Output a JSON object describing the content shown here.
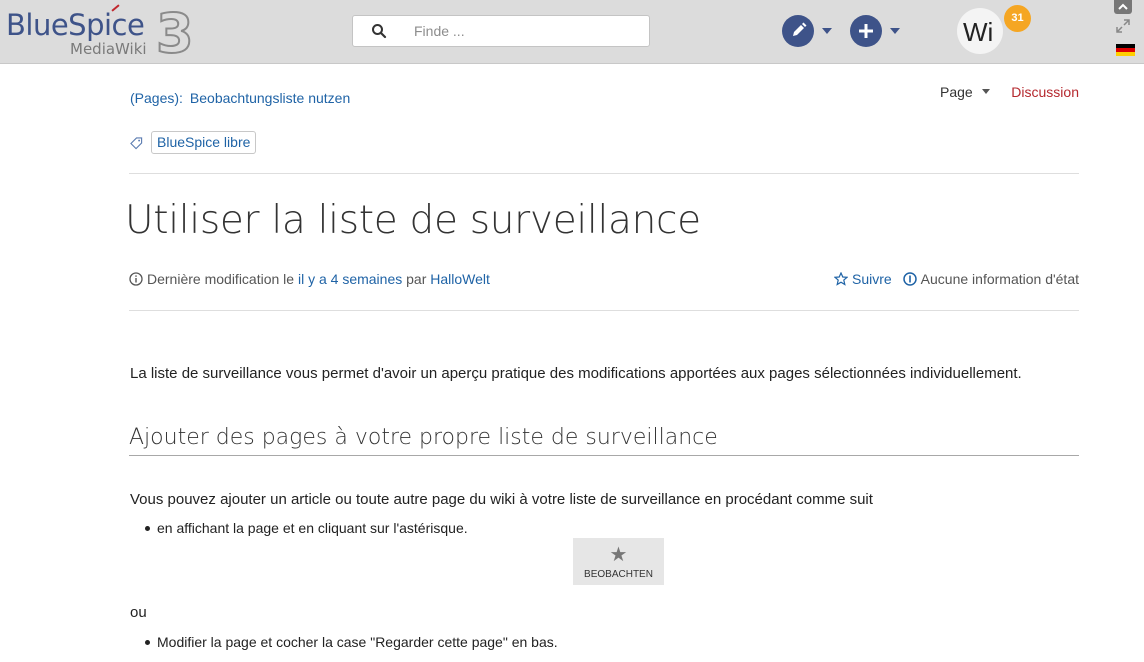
{
  "header": {
    "logo_main": "BlueSpice",
    "logo_sub": "MediaWiki",
    "logo_version": "3",
    "search_placeholder": "Finde ...",
    "avatar_initials": "Wi",
    "notification_count": "31",
    "colors": {
      "brand": "#3e5389",
      "badge": "#f5a623"
    }
  },
  "page": {
    "breadcrumb_prefix": "(Pages):",
    "breadcrumb_page": "Beobachtungsliste nutzen",
    "tab_page": "Page",
    "tab_discussion": "Discussion",
    "category_tag": "BlueSpice libre",
    "title": "Utiliser la liste de surveillance",
    "meta_prefix": "Dernière modification le ",
    "meta_time": "il y a 4 semaines",
    "meta_by": " par ",
    "meta_author": "HalloWelt",
    "follow_label": "Suivre",
    "state_label": "Aucune information d'état"
  },
  "content": {
    "intro": "La liste de surveillance vous permet d'avoir un aperçu pratique des modifications apportées aux pages sélectionnées individuellement.",
    "section_heading": "Ajouter des pages à votre propre liste de surveillance",
    "section_intro": "Vous pouvez ajouter un article ou toute autre page du wiki à votre liste de surveillance en procédant comme suit",
    "bullet_1": "en affichant la page et en cliquant sur l'astérisque.",
    "watch_button_label": "BEOBACHTEN",
    "or_text": "ou",
    "bullet_2": "Modifier la page et cocher la case \"Regarder cette page\" en bas."
  }
}
